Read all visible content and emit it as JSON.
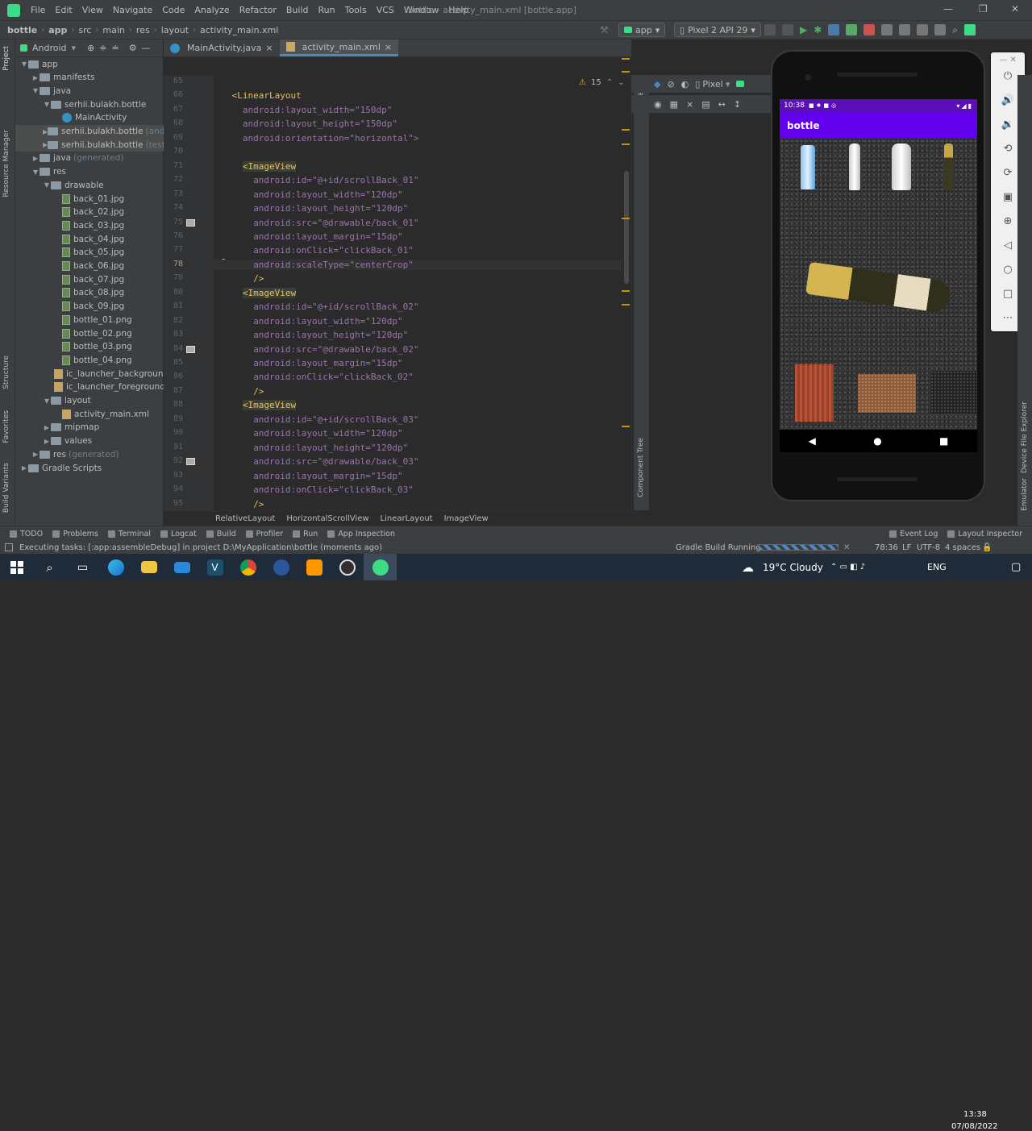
{
  "menu": {
    "items": [
      "File",
      "Edit",
      "View",
      "Navigate",
      "Code",
      "Analyze",
      "Refactor",
      "Build",
      "Run",
      "Tools",
      "VCS",
      "Window",
      "Help"
    ],
    "window_title": "bottle - activity_main.xml [bottle.app]"
  },
  "breadcrumb": [
    "bottle",
    "app",
    "src",
    "main",
    "res",
    "layout",
    "activity_main.xml"
  ],
  "toolbar": {
    "config": "app",
    "device": "Pixel 2 API 29"
  },
  "project": {
    "view": "Android",
    "tree": [
      {
        "label": "app",
        "depth": 0,
        "type": "folder",
        "open": true
      },
      {
        "label": "manifests",
        "depth": 1,
        "type": "folder"
      },
      {
        "label": "java",
        "depth": 1,
        "type": "folder",
        "open": true
      },
      {
        "label": "serhii.bulakh.bottle",
        "depth": 2,
        "type": "folder",
        "open": true
      },
      {
        "label": "MainActivity",
        "depth": 3,
        "type": "java"
      },
      {
        "label": "serhii.bulakh.bottle",
        "suffix": "(androi",
        "depth": 2,
        "type": "folder",
        "sel": true
      },
      {
        "label": "serhii.bulakh.bottle",
        "suffix": "(test)",
        "depth": 2,
        "type": "folder",
        "sel": true
      },
      {
        "label": "java",
        "suffix": "(generated)",
        "depth": 1,
        "type": "folder"
      },
      {
        "label": "res",
        "depth": 1,
        "type": "folder",
        "open": true
      },
      {
        "label": "drawable",
        "depth": 2,
        "type": "folder",
        "open": true
      },
      {
        "label": "back_01.jpg",
        "depth": 3,
        "type": "img"
      },
      {
        "label": "back_02.jpg",
        "depth": 3,
        "type": "img"
      },
      {
        "label": "back_03.jpg",
        "depth": 3,
        "type": "img"
      },
      {
        "label": "back_04.jpg",
        "depth": 3,
        "type": "img"
      },
      {
        "label": "back_05.jpg",
        "depth": 3,
        "type": "img"
      },
      {
        "label": "back_06.jpg",
        "depth": 3,
        "type": "img"
      },
      {
        "label": "back_07.jpg",
        "depth": 3,
        "type": "img"
      },
      {
        "label": "back_08.jpg",
        "depth": 3,
        "type": "img"
      },
      {
        "label": "back_09.jpg",
        "depth": 3,
        "type": "img"
      },
      {
        "label": "bottle_01.png",
        "depth": 3,
        "type": "img"
      },
      {
        "label": "bottle_02.png",
        "depth": 3,
        "type": "img"
      },
      {
        "label": "bottle_03.png",
        "depth": 3,
        "type": "img"
      },
      {
        "label": "bottle_04.png",
        "depth": 3,
        "type": "img"
      },
      {
        "label": "ic_launcher_background",
        "depth": 3,
        "type": "xml"
      },
      {
        "label": "ic_launcher_foreground",
        "depth": 3,
        "type": "xml"
      },
      {
        "label": "layout",
        "depth": 2,
        "type": "folder",
        "open": true
      },
      {
        "label": "activity_main.xml",
        "depth": 3,
        "type": "xml"
      },
      {
        "label": "mipmap",
        "depth": 2,
        "type": "folder"
      },
      {
        "label": "values",
        "depth": 2,
        "type": "folder"
      },
      {
        "label": "res",
        "suffix": "(generated)",
        "depth": 1,
        "type": "folder"
      },
      {
        "label": "Gradle Scripts",
        "depth": 0,
        "type": "gradle"
      }
    ]
  },
  "tabs": [
    {
      "label": "MainActivity.java",
      "active": false
    },
    {
      "label": "activity_main.xml",
      "active": true
    }
  ],
  "editor": {
    "warnings": "15",
    "current_line": "78",
    "lines": [
      {
        "n": "65",
        "code": ""
      },
      {
        "n": "66",
        "code": "<LinearLayout"
      },
      {
        "n": "67",
        "code": "android:layout_width=\"150dp\""
      },
      {
        "n": "68",
        "code": "android:layout_height=\"150dp\""
      },
      {
        "n": "69",
        "code": "android:orientation=\"horizontal\">"
      },
      {
        "n": "70",
        "code": ""
      },
      {
        "n": "71",
        "code": "<ImageView"
      },
      {
        "n": "72",
        "code": "android:id=\"@+id/scrollBack_01\""
      },
      {
        "n": "73",
        "code": "android:layout_width=\"120dp\""
      },
      {
        "n": "74",
        "code": "android:layout_height=\"120dp\""
      },
      {
        "n": "75",
        "code": "android:src=\"@drawable/back_01\""
      },
      {
        "n": "76",
        "code": "android:layout_margin=\"15dp\""
      },
      {
        "n": "77",
        "code": "android:onClick=\"clickBack_01\""
      },
      {
        "n": "78",
        "code": "android:scaleType=\"centerCrop\""
      },
      {
        "n": "79",
        "code": "/>"
      },
      {
        "n": "80",
        "code": "<ImageView"
      },
      {
        "n": "81",
        "code": "android:id=\"@+id/scrollBack_02\""
      },
      {
        "n": "82",
        "code": "android:layout_width=\"120dp\""
      },
      {
        "n": "83",
        "code": "android:layout_height=\"120dp\""
      },
      {
        "n": "84",
        "code": "android:src=\"@drawable/back_02\""
      },
      {
        "n": "85",
        "code": "android:layout_margin=\"15dp\""
      },
      {
        "n": "86",
        "code": "android:onClick=\"clickBack_02\""
      },
      {
        "n": "87",
        "code": "/>"
      },
      {
        "n": "88",
        "code": "<ImageView"
      },
      {
        "n": "89",
        "code": "android:id=\"@+id/scrollBack_03\""
      },
      {
        "n": "90",
        "code": "android:layout_width=\"120dp\""
      },
      {
        "n": "91",
        "code": "android:layout_height=\"120dp\""
      },
      {
        "n": "92",
        "code": "android:src=\"@drawable/back_03\""
      },
      {
        "n": "93",
        "code": "android:layout_margin=\"15dp\""
      },
      {
        "n": "94",
        "code": "android:onClick=\"clickBack_03\""
      },
      {
        "n": "95",
        "code": "/>"
      }
    ]
  },
  "xml_breadcrumb": [
    "RelativeLayout",
    "HorizontalScrollView",
    "LinearLayout",
    "ImageView"
  ],
  "design": {
    "device": "Pixel",
    "palette": "Palette",
    "component_tree": "Component Tree"
  },
  "emulator": {
    "time": "10:38",
    "app_title": "bottle"
  },
  "side_labels": {
    "left": [
      "Project",
      "Resource Manager",
      "Structure",
      "Favorites",
      "Build Variants"
    ],
    "right": [
      "Device File Explorer",
      "Emulator"
    ]
  },
  "tool_tabs": [
    "TODO",
    "Problems",
    "Terminal",
    "Logcat",
    "Build",
    "Profiler",
    "Run",
    "App Inspection"
  ],
  "tool_tabs_right": [
    "Event Log",
    "Layout Inspector"
  ],
  "status": {
    "message": "Executing tasks: [:app:assembleDebug] in project D:\\MyApplication\\bottle (moments ago)",
    "gradle": "Gradle Build Running",
    "position": "78:36",
    "line_sep": "LF",
    "encoding": "UTF-8",
    "indent": "4 spaces"
  },
  "taskbar": {
    "weather": "19°C  Cloudy",
    "lang": "ENG",
    "time": "13:38",
    "date": "07/08/2022"
  },
  "colors": {
    "accent": "#6200ee",
    "status_bar": "#5b0fb8",
    "ide_bg": "#2b2b2b",
    "panel": "#3c3f41"
  }
}
